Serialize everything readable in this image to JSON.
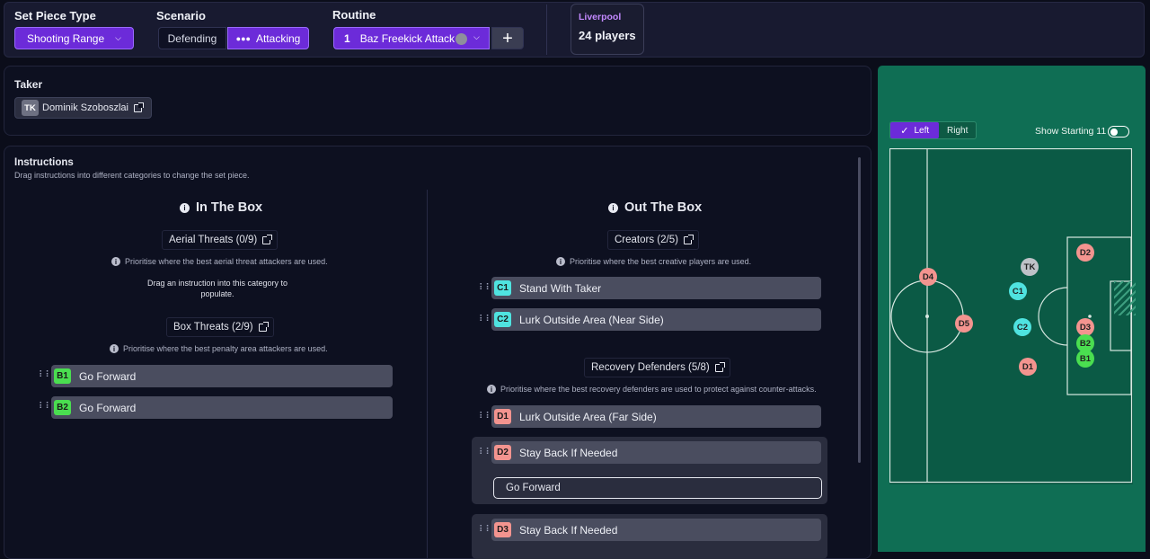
{
  "topbar": {
    "set_piece_type_label": "Set Piece Type",
    "set_piece_type_value": "Shooting Range",
    "scenario_label": "Scenario",
    "scenario_defending": "Defending",
    "scenario_attacking": "Attacking",
    "routine_label": "Routine",
    "routine_number": "1",
    "routine_name": "Baz Freekick Attack",
    "team_name": "Liverpool",
    "team_players": "24 players"
  },
  "taker": {
    "title": "Taker",
    "badge": "TK",
    "name": "Dominik Szoboszlai"
  },
  "instructions": {
    "title": "Instructions",
    "subtitle": "Drag instructions into different categories to change the set piece.",
    "in_box": {
      "heading": "In The Box",
      "aerial_title": "Aerial Threats (0/9)",
      "aerial_hint": "Prioritise where the best aerial threat attackers are used.",
      "aerial_empty_line1": "Drag an instruction into this category to",
      "aerial_empty_line2": "populate.",
      "box_title": "Box Threats (2/9)",
      "box_hint": "Prioritise where the best penalty area attackers are used.",
      "items": [
        {
          "tag": "B1",
          "label": "Go Forward"
        },
        {
          "tag": "B2",
          "label": "Go Forward"
        }
      ]
    },
    "out_box": {
      "heading": "Out The Box",
      "creators_title": "Creators (2/5)",
      "creators_hint": "Prioritise where the best creative players are used.",
      "creators": [
        {
          "tag": "C1",
          "label": "Stand With Taker"
        },
        {
          "tag": "C2",
          "label": "Lurk Outside Area (Near Side)"
        }
      ],
      "recovery_title": "Recovery Defenders (5/8)",
      "recovery_hint": "Prioritise where the best recovery defenders are used to protect against counter-attacks.",
      "recovery": [
        {
          "tag": "D1",
          "label": "Lurk Outside Area (Far Side)"
        },
        {
          "tag": "D2",
          "label": "Stay Back If Needed",
          "sub": "Go Forward"
        },
        {
          "tag": "D3",
          "label": "Stay Back If Needed"
        }
      ]
    }
  },
  "pitch": {
    "side_left": "Left",
    "side_right": "Right",
    "starting11_label": "Show Starting 11",
    "markers": [
      "D2",
      "D4",
      "TK",
      "C1",
      "D5",
      "C2",
      "D3",
      "B2",
      "B1",
      "D1"
    ]
  },
  "colors": {
    "accent": "#6c2bd9",
    "cyan_tag": "#4fe3e0",
    "green_tag": "#4ade50",
    "red_tag": "#f3948f",
    "pitch": "#0f6e54"
  }
}
